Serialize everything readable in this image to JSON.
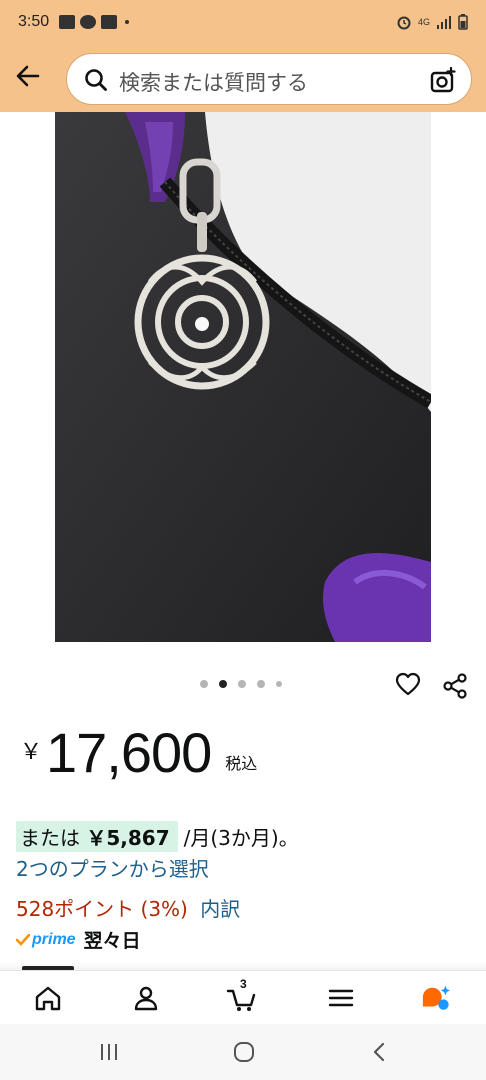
{
  "status_bar": {
    "time": "3:50",
    "network": "4G"
  },
  "search": {
    "placeholder": "検索または質問する",
    "icons": [
      "back-arrow-icon",
      "search-icon",
      "camera-icon"
    ]
  },
  "product_image": {
    "alt": "product-photo",
    "carousel_total": 5,
    "carousel_active_index": 1
  },
  "price": {
    "currency": "￥",
    "amount": "17,600",
    "tax_label": "税込"
  },
  "installment": {
    "prefix": "または",
    "amount": "￥5,867",
    "suffix": "/月(3か月)。"
  },
  "plan_link": "2つのプランから選択",
  "points": {
    "text": "528ポイント (3%)",
    "breakdown": "内訳"
  },
  "prime": {
    "label": "prime",
    "delivery": "翌々日"
  },
  "bottom_nav": {
    "cart_count": "3",
    "items": [
      "home-icon",
      "account-icon",
      "cart-icon",
      "menu-icon",
      "assistant-icon"
    ]
  },
  "colors": {
    "header_bg": "#f4c28a",
    "link": "#1f5f8b",
    "points": "#b12704",
    "prime": "#1a98ff",
    "installment_bg": "#d6f3e5",
    "assistant_orange": "#ff6a00",
    "assistant_blue": "#1a98ff"
  }
}
